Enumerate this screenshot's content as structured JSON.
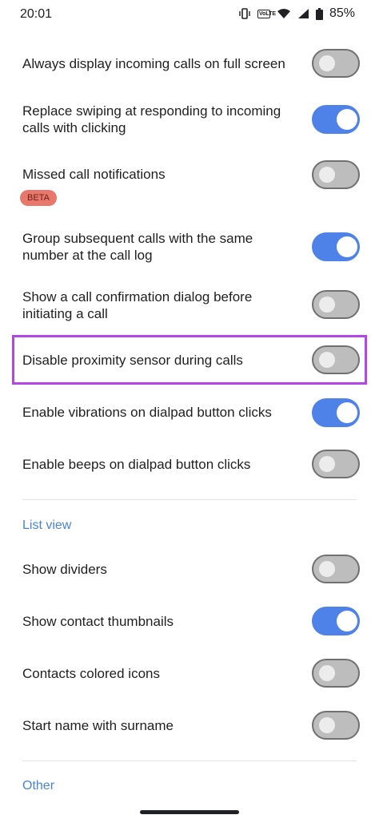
{
  "status_bar": {
    "time": "20:01",
    "battery_percent": "85%",
    "volte_text": "VoLTE",
    "icons": [
      "vibrate-icon",
      "volte-icon",
      "wifi-icon",
      "signal-icon",
      "battery-icon"
    ]
  },
  "settings": [
    {
      "label": "Always display incoming calls on full screen",
      "enabled": false
    },
    {
      "label": "Replace swiping at responding to incoming calls with clicking",
      "enabled": true
    },
    {
      "label": "Missed call notifications",
      "enabled": false,
      "badge": "BETA"
    },
    {
      "label": "Group subsequent calls with the same number at the call log",
      "enabled": true
    },
    {
      "label": "Show a call confirmation dialog before initiating a call",
      "enabled": false
    },
    {
      "label": "Disable proximity sensor during calls",
      "enabled": false,
      "highlighted": true
    },
    {
      "label": "Enable vibrations on dialpad button clicks",
      "enabled": true
    },
    {
      "label": "Enable beeps on dialpad button clicks",
      "enabled": false
    }
  ],
  "sections": {
    "list_view": "List view",
    "other": "Other"
  },
  "list_view_settings": [
    {
      "label": "Show dividers",
      "enabled": false
    },
    {
      "label": "Show contact thumbnails",
      "enabled": true
    },
    {
      "label": "Contacts colored icons",
      "enabled": false
    },
    {
      "label": "Start name with surname",
      "enabled": false
    }
  ],
  "colors": {
    "toggle_on": "#4f82e8",
    "toggle_off": "#bdbdbd",
    "highlight_border": "#b445e8",
    "section_header": "#4a84d8",
    "beta_badge": "#e8786c"
  }
}
